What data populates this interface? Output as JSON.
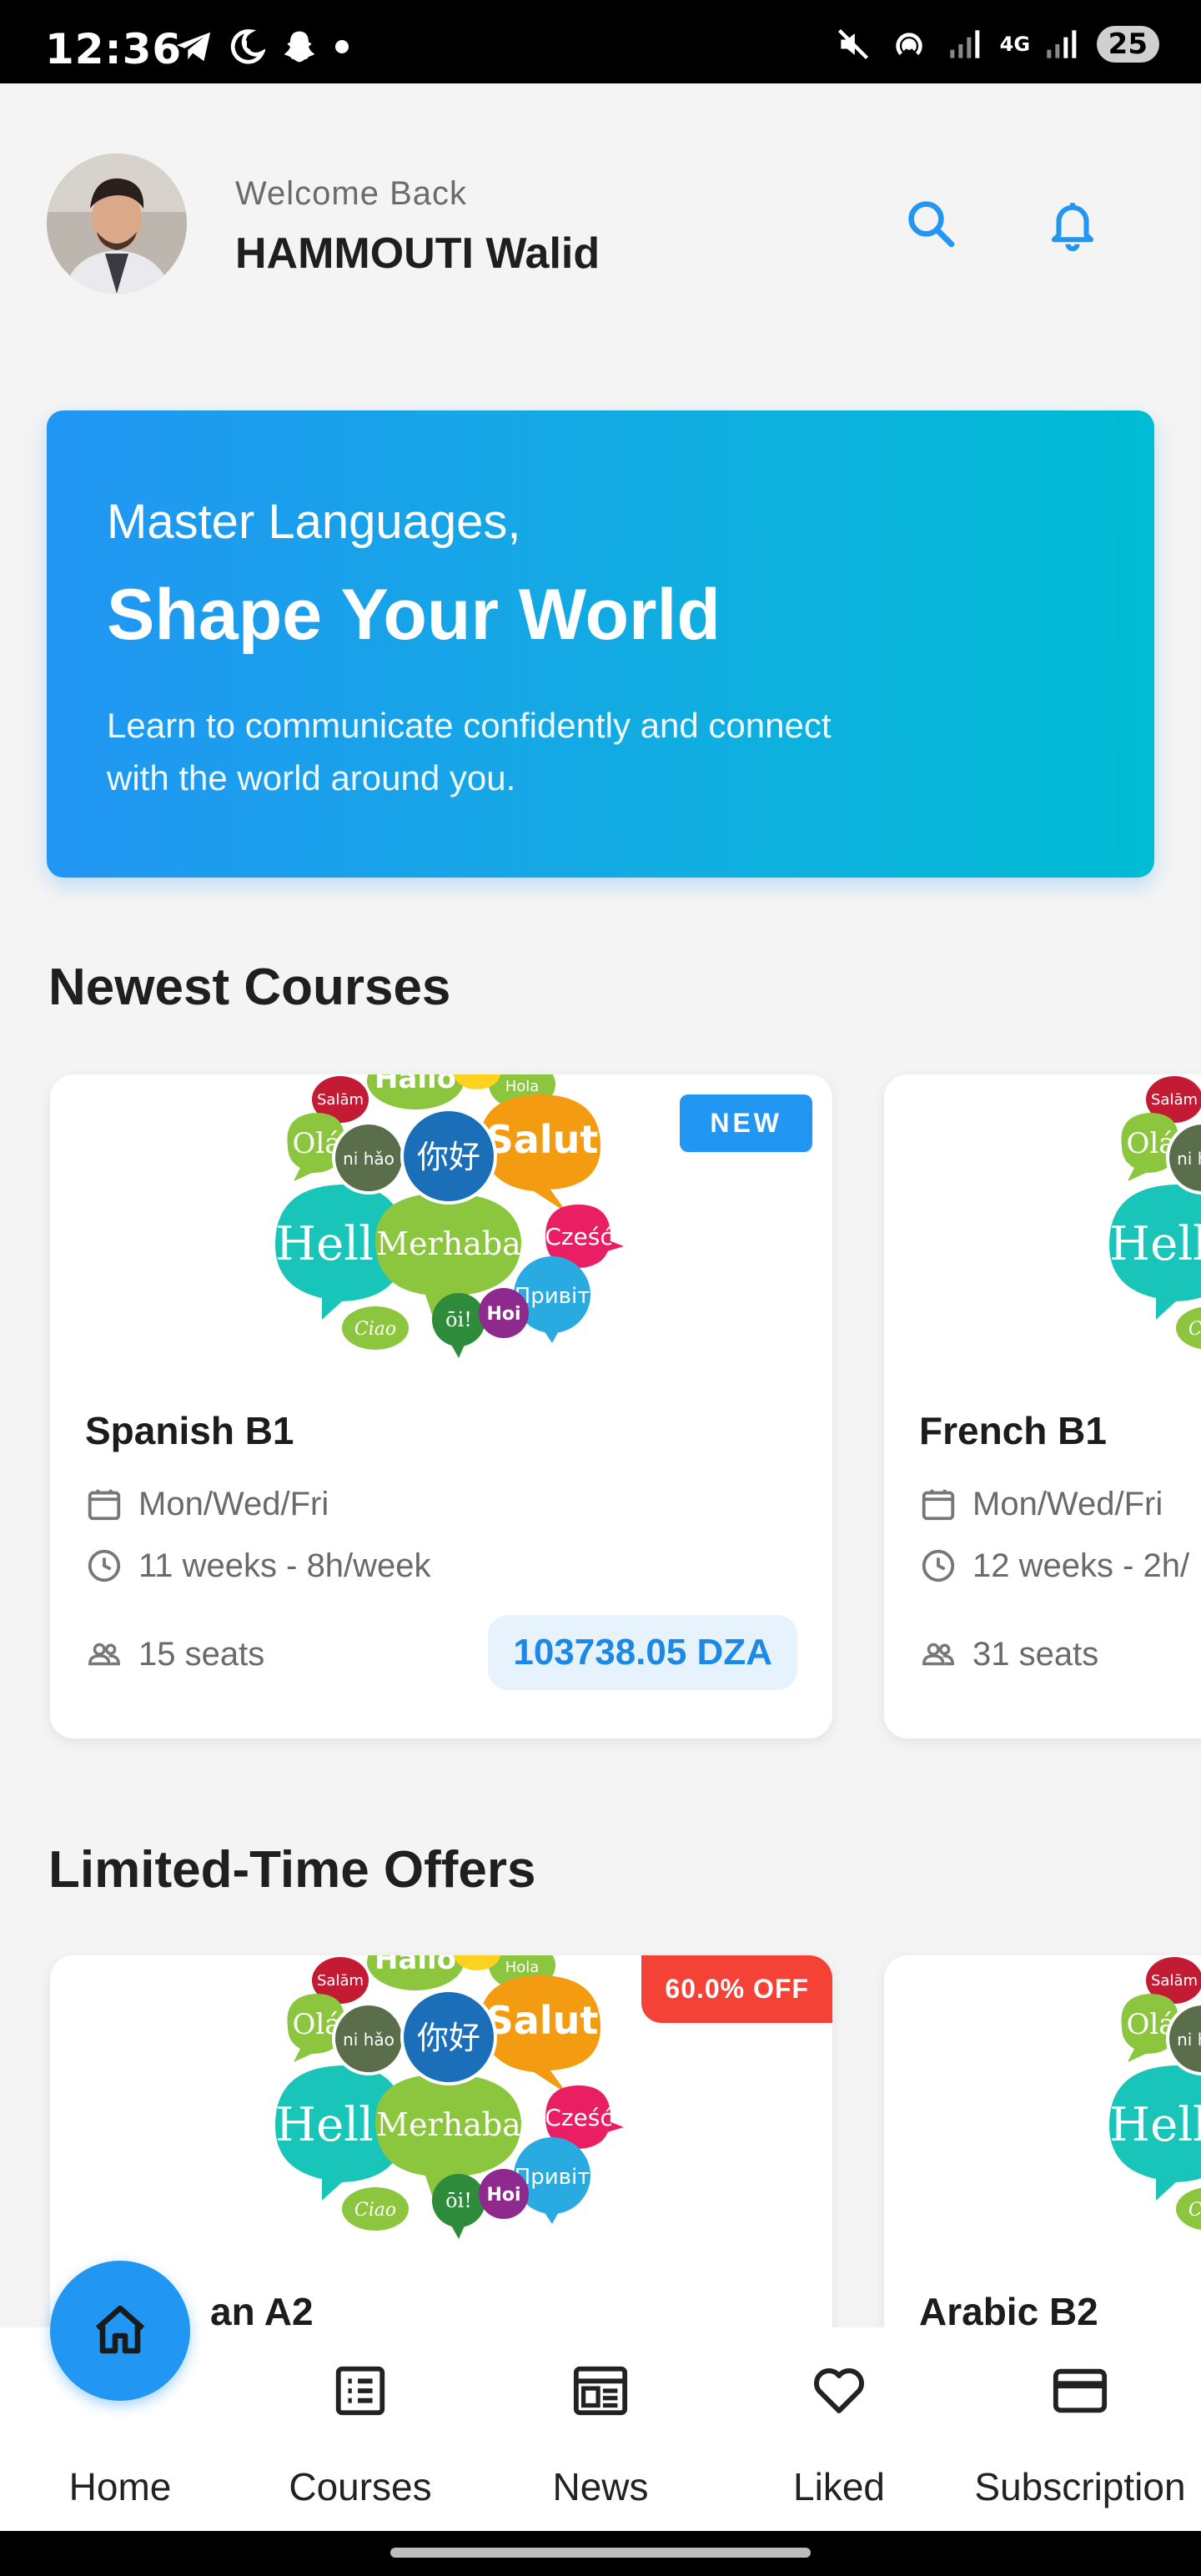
{
  "status_bar": {
    "time": "12:36",
    "battery": "25",
    "network": "4G",
    "icons_left": [
      "telegram-icon",
      "moon-icon",
      "snapchat-icon",
      "dot-icon"
    ],
    "icons_right": [
      "mute-icon",
      "hotspot-icon",
      "signal-icon",
      "signal-icon"
    ]
  },
  "header": {
    "welcome": "Welcome Back",
    "username": "HAMMOUTI Walid"
  },
  "hero": {
    "line1": "Master Languages,",
    "line2": "Shape Your World",
    "description": "Learn to communicate confidently and connect with the world around you."
  },
  "newest": {
    "title": "Newest Courses",
    "courses": [
      {
        "badge": "NEW",
        "title": "Spanish B1",
        "schedule": "Mon/Wed/Fri",
        "duration": "11 weeks - 8h/week",
        "seats": "15 seats",
        "price": "103738.05 DZA"
      },
      {
        "title": "French B1",
        "schedule": "Mon/Wed/Fri",
        "duration": "12 weeks - 2h/",
        "seats": "31 seats"
      }
    ]
  },
  "offers": {
    "title": "Limited-Time Offers",
    "courses": [
      {
        "badge": "60.0% OFF",
        "title": "an A2"
      },
      {
        "title": "Arabic B2"
      }
    ]
  },
  "bubble_words": [
    "Salām",
    "Hallo",
    "Hola",
    "Olá",
    "ni hǎo",
    "你好",
    "Salut",
    "Hello",
    "Merhaba",
    "Cześć",
    "Привіт",
    "Ciao",
    "ōi!",
    "Hoi"
  ],
  "nav": {
    "items": [
      {
        "label": "Home",
        "icon": "home-icon"
      },
      {
        "label": "Courses",
        "icon": "list-icon"
      },
      {
        "label": "News",
        "icon": "news-icon"
      },
      {
        "label": "Liked",
        "icon": "heart-icon"
      },
      {
        "label": "Subscription",
        "icon": "card-icon"
      }
    ]
  },
  "colors": {
    "primary": "#2196f3",
    "hero_gradient_end": "#00bcd4",
    "offer_badge": "#f44336",
    "price_text": "#1e88e5"
  }
}
